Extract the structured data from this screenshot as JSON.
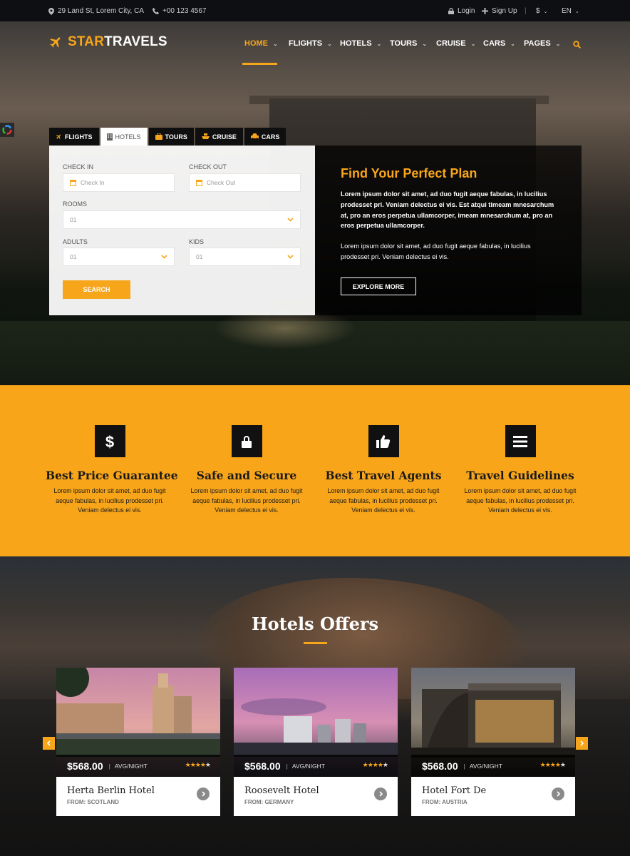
{
  "topbar": {
    "address": "29 Land St, Lorem City, CA",
    "phone": "+00 123 4567",
    "login": "Login",
    "signup": "Sign Up",
    "currency": "$",
    "language": "EN"
  },
  "brand": {
    "star": "STAR",
    "travels": "TRAVELS"
  },
  "nav": [
    {
      "label": "HOME"
    },
    {
      "label": "FLIGHTS"
    },
    {
      "label": "HOTELS"
    },
    {
      "label": "TOURS"
    },
    {
      "label": "CRUISE"
    },
    {
      "label": "CARS"
    },
    {
      "label": "PAGES"
    }
  ],
  "tabs": [
    {
      "label": "FLIGHTS"
    },
    {
      "label": "HOTELS"
    },
    {
      "label": "TOURS"
    },
    {
      "label": "CRUISE"
    },
    {
      "label": "CARS"
    }
  ],
  "search_form": {
    "checkin_label": "CHECK IN",
    "checkin_placeholder": "Check In",
    "checkout_label": "CHECK OUT",
    "checkout_placeholder": "Check Out",
    "rooms_label": "ROOMS",
    "rooms_value": "01",
    "adults_label": "ADULTS",
    "adults_value": "01",
    "kids_label": "KIDS",
    "kids_value": "01",
    "search_button": "SEARCH"
  },
  "promo": {
    "title": "Find Your Perfect Plan",
    "bold_text": "Lorem ipsum dolor sit amet, ad duo fugit aeque fabulas, in lucilius prodesset pri. Veniam delectus ei vis. Est atqui timeam mnesarchum at, pro an eros perpetua ullamcorper, imeam mnesarchum at, pro an eros perpetua ullamcorper.",
    "text": "Lorem ipsum dolor sit amet, ad duo fugit aeque fabulas, in lucilius prodesset pri. Veniam delectus ei vis.",
    "button": "EXPLORE MORE"
  },
  "features": [
    {
      "icon": "dollar-icon",
      "title": "Best Price Guarantee",
      "text": "Lorem ipsum dolor sit amet, ad duo fugit aeque fabulas, in lucilius prodesset pri. Veniam delectus ei vis."
    },
    {
      "icon": "lock-icon",
      "title": "Safe and Secure",
      "text": "Lorem ipsum dolor sit amet, ad duo fugit aeque fabulas, in lucilius prodesset pri. Veniam delectus ei vis."
    },
    {
      "icon": "thumbs-up-icon",
      "title": "Best Travel Agents",
      "text": "Lorem ipsum dolor sit amet, ad duo fugit aeque fabulas, in lucilius prodesset pri. Veniam delectus ei vis."
    },
    {
      "icon": "menu-icon",
      "title": "Travel Guidelines",
      "text": "Lorem ipsum dolor sit amet, ad duo fugit aeque fabulas, in lucilius prodesset pri. Veniam delectus ei vis."
    }
  ],
  "hotels": {
    "title": "Hotels Offers",
    "items": [
      {
        "price": "$568.00",
        "unit": "AVG/NIGHT",
        "rating": 4,
        "name": "Herta Berlin Hotel",
        "from": "FROM: SCOTLAND"
      },
      {
        "price": "$568.00",
        "unit": "AVG/NIGHT",
        "rating": 4,
        "name": "Roosevelt Hotel",
        "from": "FROM: GERMANY"
      },
      {
        "price": "$568.00",
        "unit": "AVG/NIGHT",
        "rating": 4,
        "name": "Hotel Fort De",
        "from": "FROM: AUSTRIA"
      }
    ]
  },
  "colors": {
    "accent": "#f7a61b",
    "dark": "#0d0f12"
  }
}
